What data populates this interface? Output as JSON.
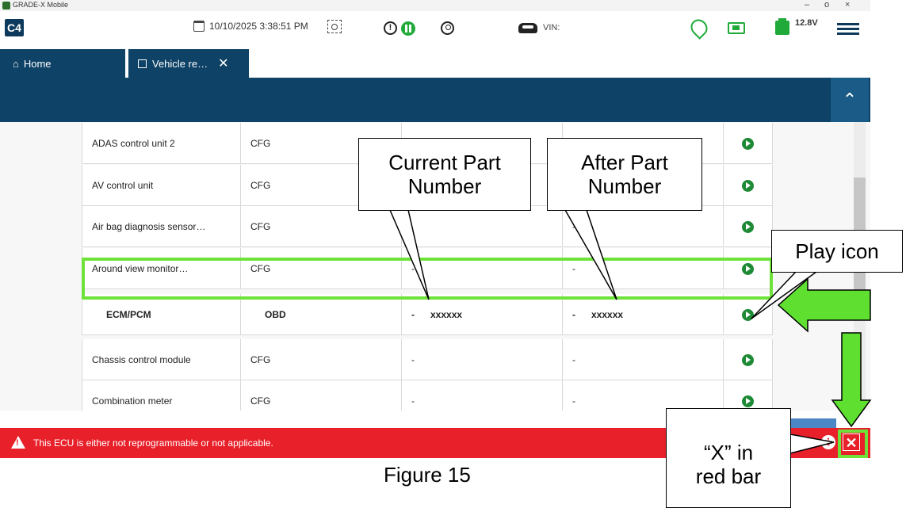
{
  "window": {
    "title": "GRADE-X Mobile",
    "min": "–",
    "max": "o",
    "close": "×"
  },
  "toolbar": {
    "logo": "C4",
    "datetime": "10/10/2025 3:38:51 PM",
    "vin_label": "VIN:",
    "voltage": "12.8V"
  },
  "tabs": [
    {
      "label": "Home",
      "icon": "home-icon"
    },
    {
      "label": "Vehicle re…",
      "icon": "chip-icon"
    }
  ],
  "table": {
    "rows": [
      {
        "name": "ADAS control unit 2",
        "type": "CFG",
        "current": "",
        "after": ""
      },
      {
        "name": "AV control unit",
        "type": "CFG",
        "current": "",
        "after": ""
      },
      {
        "name": "Air bag diagnosis sensor…",
        "type": "CFG",
        "current": "",
        "after": "-"
      },
      {
        "name": "Around view monitor…",
        "type": "CFG",
        "current": "-",
        "after": "-"
      },
      {
        "name": "ECM/PCM",
        "type": "OBD",
        "current": "-      xxxxxx",
        "after": "-      xxxxxx"
      },
      {
        "name": "Chassis control module",
        "type": "CFG",
        "current": "-",
        "after": "-"
      },
      {
        "name": "Combination meter",
        "type": "CFG",
        "current": "-",
        "after": "-"
      }
    ]
  },
  "error_bar": {
    "message": "This ECU is either not reprogrammable or not applicable."
  },
  "callouts": {
    "current": "Current Part Number",
    "after": "After Part Number",
    "play": "Play icon",
    "x_line1": "“X” in",
    "x_line2": "red bar"
  },
  "figure_label": "Figure 15",
  "colors": {
    "navy": "#0e4266",
    "green": "#1e8a35",
    "highlight": "#6ee23a",
    "error_red": "#e8202a"
  }
}
